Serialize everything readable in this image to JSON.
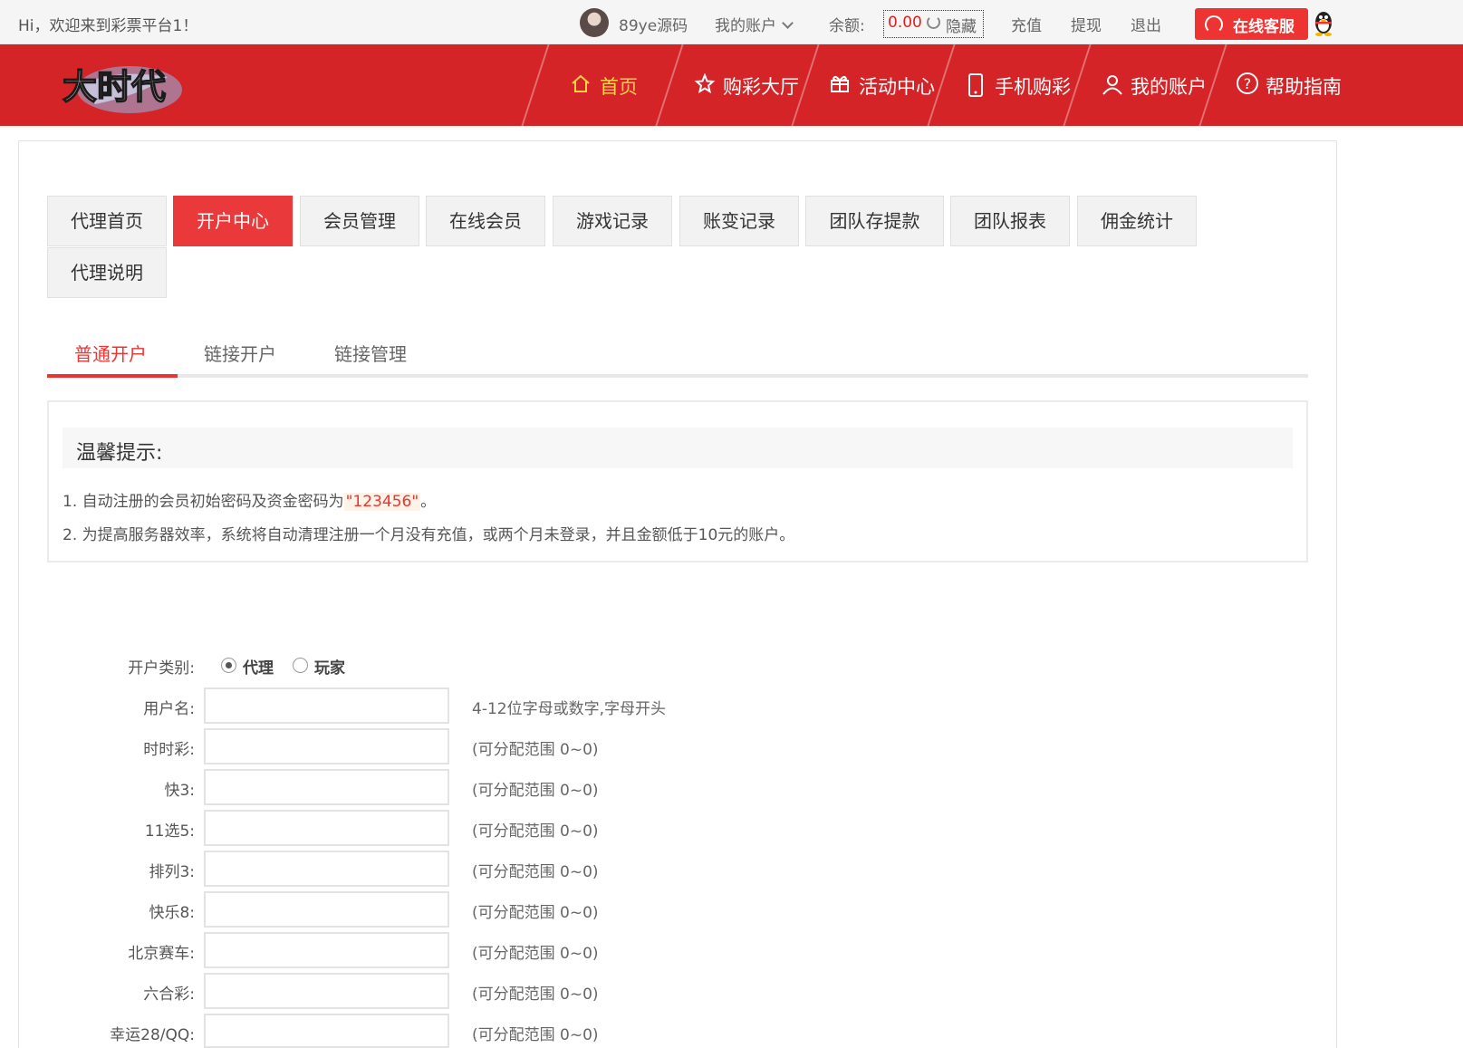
{
  "topbar": {
    "greeting": "Hi，欢迎来到彩票平台1！",
    "username": "89ye源码",
    "my_account": "我的账户",
    "balance_label": "余额:",
    "balance_value": "0.00",
    "hide_label": "隐藏",
    "recharge": "充值",
    "withdraw": "提现",
    "logout": "退出",
    "service": "在线客服"
  },
  "nav": {
    "items": [
      {
        "label": "首页"
      },
      {
        "label": "购彩大厅"
      },
      {
        "label": "活动中心"
      },
      {
        "label": "手机购彩"
      },
      {
        "label": "我的账户"
      },
      {
        "label": "帮助指南"
      }
    ]
  },
  "tabs": [
    {
      "label": "代理首页"
    },
    {
      "label": "开户中心"
    },
    {
      "label": "会员管理"
    },
    {
      "label": "在线会员"
    },
    {
      "label": "游戏记录"
    },
    {
      "label": "账变记录"
    },
    {
      "label": "团队存提款"
    },
    {
      "label": "团队报表"
    },
    {
      "label": "佣金统计"
    },
    {
      "label": "代理说明"
    }
  ],
  "subtabs": [
    {
      "label": "普通开户"
    },
    {
      "label": "链接开户"
    },
    {
      "label": "链接管理"
    }
  ],
  "tips": {
    "title": "温馨提示:",
    "line1_prefix": "1. 自动注册的会员初始密码及资金密码为",
    "line1_password": "\"123456\"",
    "line1_suffix": "。",
    "line2": "2. 为提高服务器效率，系统将自动清理注册一个月没有充值，或两个月未登录，并且金额低于10元的账户。"
  },
  "form": {
    "type_label": "开户类别:",
    "type_agent": "代理",
    "type_player": "玩家",
    "username_label": "用户名:",
    "username_hint": "4-12位字母或数字,字母开头",
    "rows": [
      {
        "label": "时时彩:",
        "hint": "(可分配范围 0~0)"
      },
      {
        "label": "快3:",
        "hint": "(可分配范围 0~0)"
      },
      {
        "label": "11选5:",
        "hint": "(可分配范围 0~0)"
      },
      {
        "label": "排列3:",
        "hint": "(可分配范围 0~0)"
      },
      {
        "label": "快乐8:",
        "hint": "(可分配范围 0~0)"
      },
      {
        "label": "北京赛车:",
        "hint": "(可分配范围 0~0)"
      },
      {
        "label": "六合彩:",
        "hint": "(可分配范围 0~0)"
      },
      {
        "label": "幸运28/QQ:",
        "hint": "(可分配范围 0~0)"
      }
    ]
  }
}
